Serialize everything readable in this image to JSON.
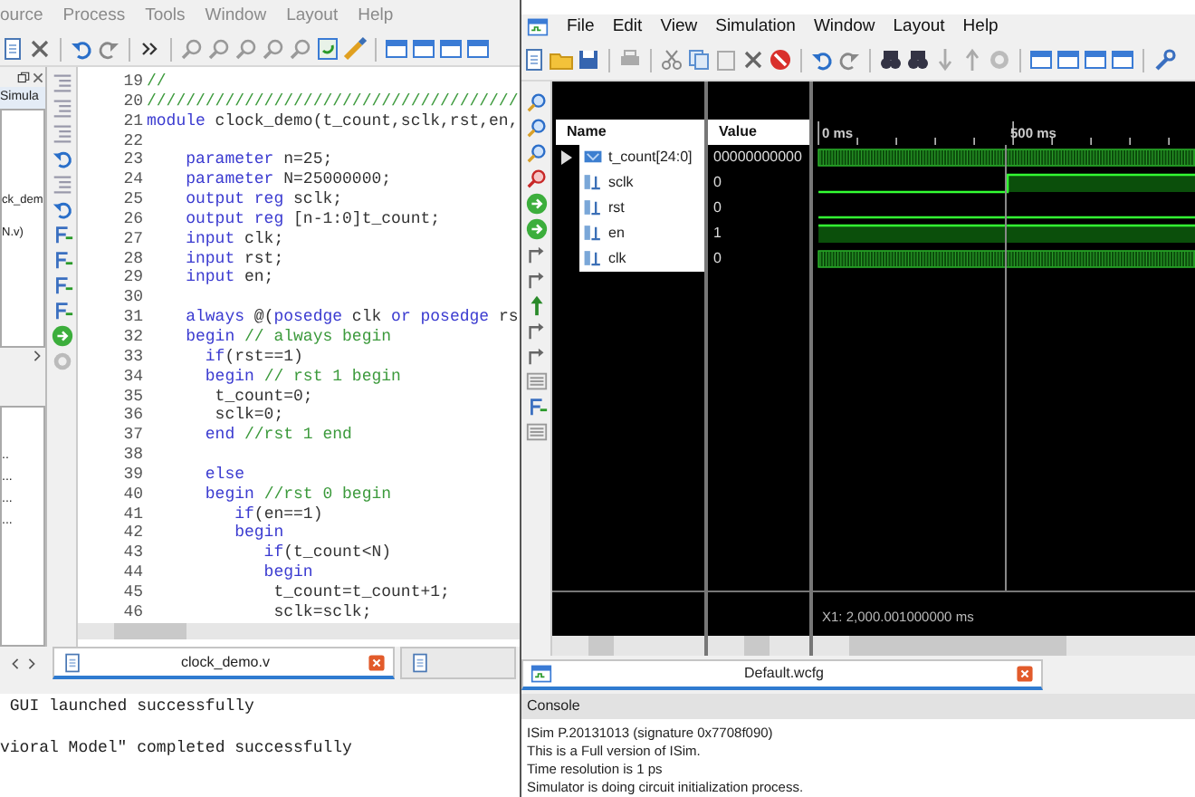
{
  "ise_window": {
    "menu": [
      "ource",
      "Process",
      "Tools",
      "Window",
      "Layout",
      "Help"
    ],
    "sources_panel": {
      "tab": "Simula",
      "items": [
        "ck_dem",
        "N.v)"
      ]
    },
    "lower_panel": {
      "items": [
        "..",
        "...",
        "...",
        "..."
      ]
    },
    "editor": {
      "lines": [
        {
          "number": "19",
          "code": [
            {
              "kind": "comment",
              "text": "//"
            }
          ]
        },
        {
          "number": "20",
          "code": [
            {
              "kind": "comment",
              "text": "//////////////////////////////////////"
            }
          ]
        },
        {
          "number": "21",
          "code": [
            {
              "kind": "keyword",
              "text": "module"
            },
            {
              "kind": "plain",
              "text": " clock_demo(t_count,sclk,rst,en,"
            }
          ]
        },
        {
          "number": "22"
        },
        {
          "number": "23",
          "code": [
            {
              "kind": "keyword",
              "text": "    parameter"
            },
            {
              "kind": "plain",
              "text": " n=25;"
            }
          ]
        },
        {
          "number": "24",
          "code": [
            {
              "kind": "keyword",
              "text": "    parameter"
            },
            {
              "kind": "plain",
              "text": " N=25000000;"
            }
          ]
        },
        {
          "number": "25",
          "code": [
            {
              "kind": "keyword",
              "text": "    output reg"
            },
            {
              "kind": "plain",
              "text": " sclk;"
            }
          ]
        },
        {
          "number": "26",
          "code": [
            {
              "kind": "keyword",
              "text": "    output reg"
            },
            {
              "kind": "plain",
              "text": " [n-1:0]t_count;"
            }
          ]
        },
        {
          "number": "27",
          "code": [
            {
              "kind": "keyword",
              "text": "    input"
            },
            {
              "kind": "plain",
              "text": " clk;"
            }
          ]
        },
        {
          "number": "28",
          "code": [
            {
              "kind": "keyword",
              "text": "    input"
            },
            {
              "kind": "plain",
              "text": " rst;"
            }
          ]
        },
        {
          "number": "29",
          "code": [
            {
              "kind": "keyword",
              "text": "    input"
            },
            {
              "kind": "plain",
              "text": " en;"
            }
          ]
        },
        {
          "number": "30"
        },
        {
          "number": "31",
          "code": [
            {
              "kind": "keyword",
              "text": "    always"
            },
            {
              "kind": "plain",
              "text": " @("
            },
            {
              "kind": "keyword",
              "text": "posedge"
            },
            {
              "kind": "plain",
              "text": " clk "
            },
            {
              "kind": "keyword",
              "text": "or"
            },
            {
              "kind": "keyword",
              "text": " posedge"
            },
            {
              "kind": "plain",
              "text": " rs"
            }
          ]
        },
        {
          "number": "32",
          "code": [
            {
              "kind": "keyword",
              "text": "    begin"
            },
            {
              "kind": "comment",
              "text": " // always begin"
            }
          ]
        },
        {
          "number": "33",
          "code": [
            {
              "kind": "keyword",
              "text": "      if"
            },
            {
              "kind": "plain",
              "text": "(rst==1)"
            }
          ]
        },
        {
          "number": "34",
          "code": [
            {
              "kind": "keyword",
              "text": "      begin"
            },
            {
              "kind": "comment",
              "text": " // rst 1 begin"
            }
          ]
        },
        {
          "number": "35",
          "code": [
            {
              "kind": "plain",
              "text": "       t_count=0;"
            }
          ]
        },
        {
          "number": "36",
          "code": [
            {
              "kind": "plain",
              "text": "       sclk=0;"
            }
          ]
        },
        {
          "number": "37",
          "code": [
            {
              "kind": "keyword",
              "text": "      end"
            },
            {
              "kind": "comment",
              "text": " //rst 1 end"
            }
          ]
        },
        {
          "number": "38"
        },
        {
          "number": "39",
          "code": [
            {
              "kind": "keyword",
              "text": "      else"
            }
          ]
        },
        {
          "number": "40",
          "code": [
            {
              "kind": "keyword",
              "text": "      begin"
            },
            {
              "kind": "comment",
              "text": " //rst 0 begin"
            }
          ]
        },
        {
          "number": "41",
          "code": [
            {
              "kind": "keyword",
              "text": "         if"
            },
            {
              "kind": "plain",
              "text": "(en==1)"
            }
          ]
        },
        {
          "number": "42",
          "code": [
            {
              "kind": "keyword",
              "text": "         begin"
            }
          ]
        },
        {
          "number": "43",
          "code": [
            {
              "kind": "keyword",
              "text": "            if"
            },
            {
              "kind": "plain",
              "text": "(t_count<N)"
            }
          ]
        },
        {
          "number": "44",
          "code": [
            {
              "kind": "keyword",
              "text": "            begin"
            }
          ]
        },
        {
          "number": "45",
          "code": [
            {
              "kind": "plain",
              "text": "             t_count=t_count+1;"
            }
          ]
        },
        {
          "number": "46",
          "code": [
            {
              "kind": "plain",
              "text": "             sclk=sclk;"
            }
          ]
        }
      ]
    },
    "tabs": [
      {
        "label": "clock_demo.v",
        "selected": true
      },
      {
        "selected": false
      }
    ],
    "console": {
      "lines": [
        " GUI launched successfully",
        "vioral Model\" completed successfully"
      ]
    }
  },
  "isim_window": {
    "menu": [
      "File",
      "Edit",
      "View",
      "Simulation",
      "Window",
      "Layout",
      "Help"
    ],
    "columns": {
      "name": "Name",
      "value": "Value"
    },
    "signals": [
      {
        "name": "t_count[24:0]",
        "kind": "bus",
        "expanded": false,
        "value": "00000000000"
      },
      {
        "name": "sclk",
        "kind": "bit",
        "value": "0"
      },
      {
        "name": "rst",
        "kind": "bit",
        "value": "0"
      },
      {
        "name": "en",
        "kind": "bit",
        "value": "1"
      },
      {
        "name": "clk",
        "kind": "bit",
        "value": "0"
      }
    ],
    "ruler": [
      "0 ms",
      "500 ms"
    ],
    "cursor_readout": "X1: 2,000.001000000 ms",
    "tabs": [
      {
        "label": "Default.wcfg",
        "selected": true
      }
    ],
    "console": {
      "title": "Console",
      "lines": [
        "ISim P.20131013 (signature 0x7708f090)",
        "This is a Full version of ISim.",
        "Time resolution is 1 ps",
        "Simulator is doing circuit initialization process."
      ]
    }
  }
}
